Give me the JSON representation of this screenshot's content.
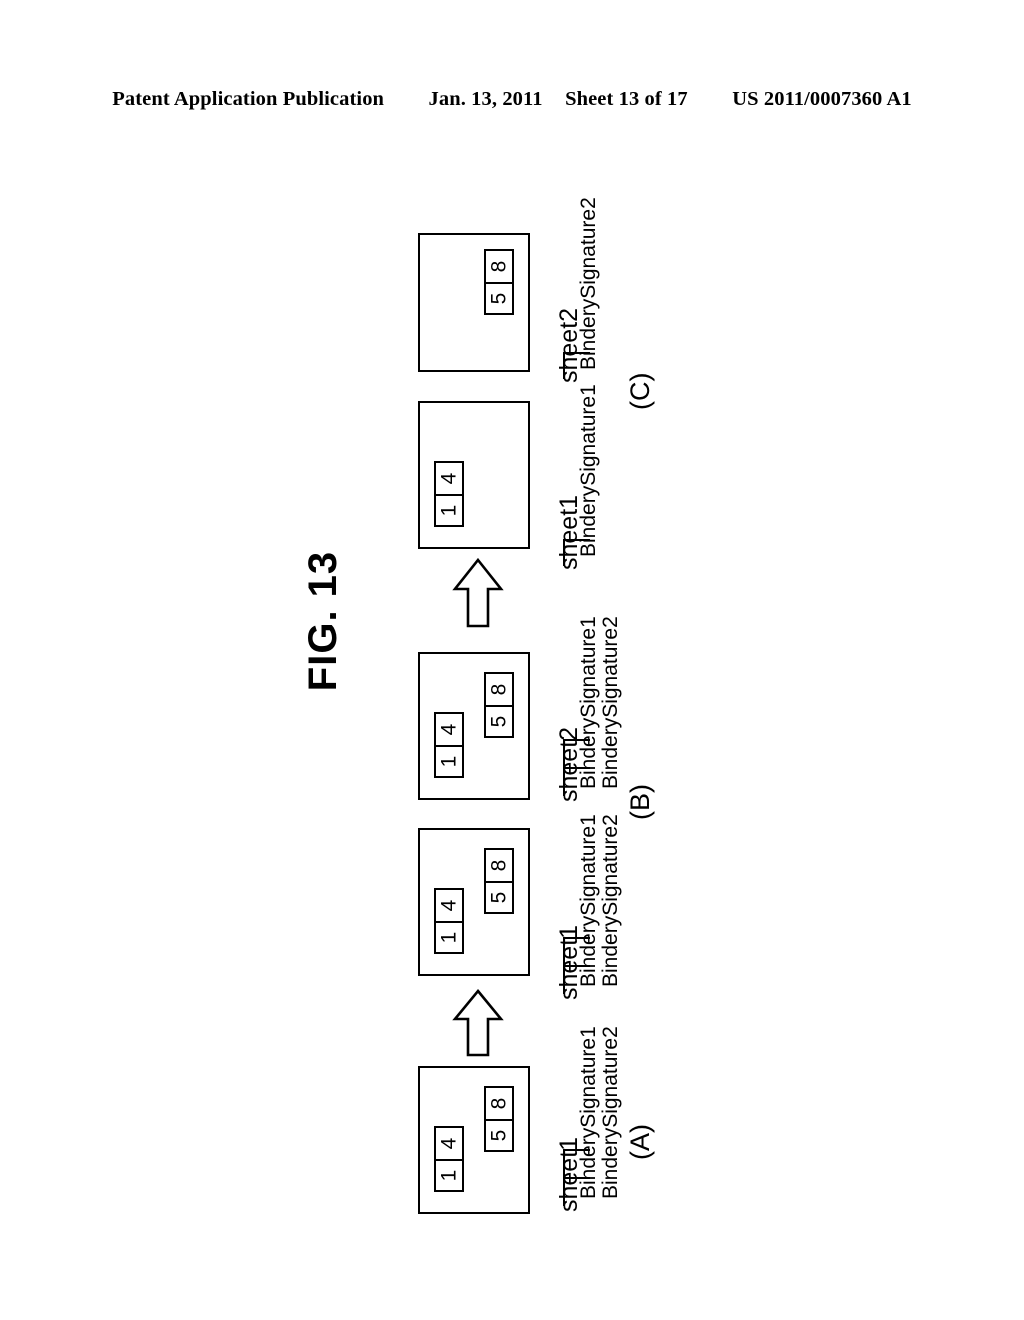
{
  "header": {
    "publication": "Patent Application Publication",
    "date": "Jan. 13, 2011",
    "sheet": "Sheet 13 of 17",
    "number": "US 2011/0007360 A1"
  },
  "figure": {
    "title": "FIG. 13"
  },
  "labels": {
    "sheet1": "sheet1",
    "sheet2": "sheet2",
    "bindery_signature1": "BinderySignature1",
    "bindery_signature2": "BinderySignature2",
    "part_a": "(A)",
    "part_b": "(B)",
    "part_c": "(C)"
  },
  "pages": {
    "p1": "1",
    "p4": "4",
    "p5": "5",
    "p8": "8"
  },
  "icons": {
    "arrow_up_1": "arrow-up-icon",
    "arrow_up_2": "arrow-up-icon"
  },
  "colors": {
    "ink": "#000000",
    "paper": "#ffffff"
  },
  "diagram": {
    "type": "patent-figure",
    "parts": [
      {
        "id": "A",
        "label": "(A)",
        "sheets": [
          {
            "name": "sheet1",
            "signatures": [
              "BinderySignature1",
              "BinderySignature2"
            ],
            "page_pairs": [
              [
                "1",
                "4"
              ],
              [
                "5",
                "8"
              ]
            ]
          }
        ]
      },
      {
        "id": "B",
        "label": "(B)",
        "sheets": [
          {
            "name": "sheet1",
            "signatures": [
              "BinderySignature1",
              "BinderySignature2"
            ],
            "page_pairs": [
              [
                "1",
                "4"
              ],
              [
                "5",
                "8"
              ]
            ]
          },
          {
            "name": "sheet2",
            "signatures": [
              "BinderySignature1",
              "BinderySignature2"
            ],
            "page_pairs": [
              [
                "1",
                "4"
              ],
              [
                "5",
                "8"
              ]
            ]
          }
        ]
      },
      {
        "id": "C",
        "label": "(C)",
        "sheets": [
          {
            "name": "sheet1",
            "signatures": [
              "BinderySignature1"
            ],
            "page_pairs": [
              [
                "1",
                "4"
              ]
            ]
          },
          {
            "name": "sheet2",
            "signatures": [
              "BinderySignature2"
            ],
            "page_pairs": [
              [
                "5",
                "8"
              ]
            ]
          }
        ]
      }
    ]
  }
}
